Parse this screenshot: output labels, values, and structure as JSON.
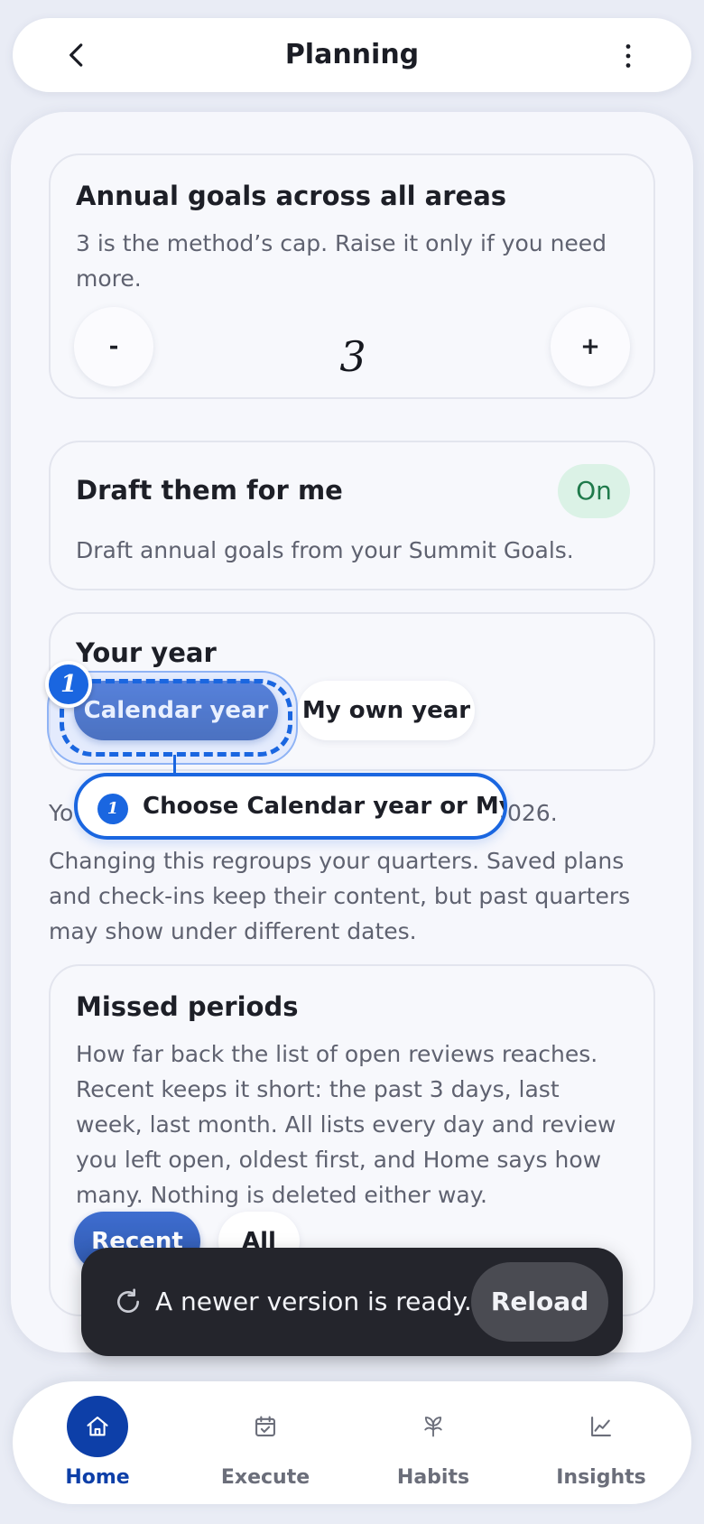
{
  "header": {
    "title": "Planning"
  },
  "annual_goals": {
    "title": "Annual goals across all areas",
    "description": "3 is the method’s cap. Raise it only if you need more.",
    "minus_label": "-",
    "plus_label": "+",
    "value": "3"
  },
  "draft": {
    "title": "Draft them for me",
    "toggle_label": "On",
    "description": "Draft annual goals from your Summit Goals."
  },
  "your_year": {
    "title": "Your year",
    "options": [
      "Calendar year",
      "My own year"
    ],
    "selected": "Calendar year",
    "note_start": "Yo",
    "note_end": "026.",
    "change_note": "Changing this regroups your quarters. Saved plans and check-ins keep their content, but past quarters may show under different dates."
  },
  "tooltip": {
    "badge": "1",
    "text": "Choose Calendar year or My own year"
  },
  "missed_periods": {
    "title": "Missed periods",
    "description": "How far back the list of open reviews reaches. Recent keeps it short: the past 3 days, last week, last month. All lists every day and review you left open, oldest first, and Home says how many. Nothing is deleted either way.",
    "options": [
      "Recent",
      "All"
    ],
    "selected": "Recent"
  },
  "toast": {
    "message": "A newer version is ready.",
    "action": "Reload"
  },
  "nav": {
    "items": [
      {
        "label": "Home",
        "icon": "home-icon"
      },
      {
        "label": "Execute",
        "icon": "calendar-check-icon"
      },
      {
        "label": "Habits",
        "icon": "sprout-icon"
      },
      {
        "label": "Insights",
        "icon": "chart-line-icon"
      }
    ],
    "active": "Home"
  },
  "colors": {
    "accent": "#0d3fa8",
    "focus": "#1a66e0",
    "toggle_on_bg": "#dbf2e6",
    "toast_bg": "#24252c"
  }
}
